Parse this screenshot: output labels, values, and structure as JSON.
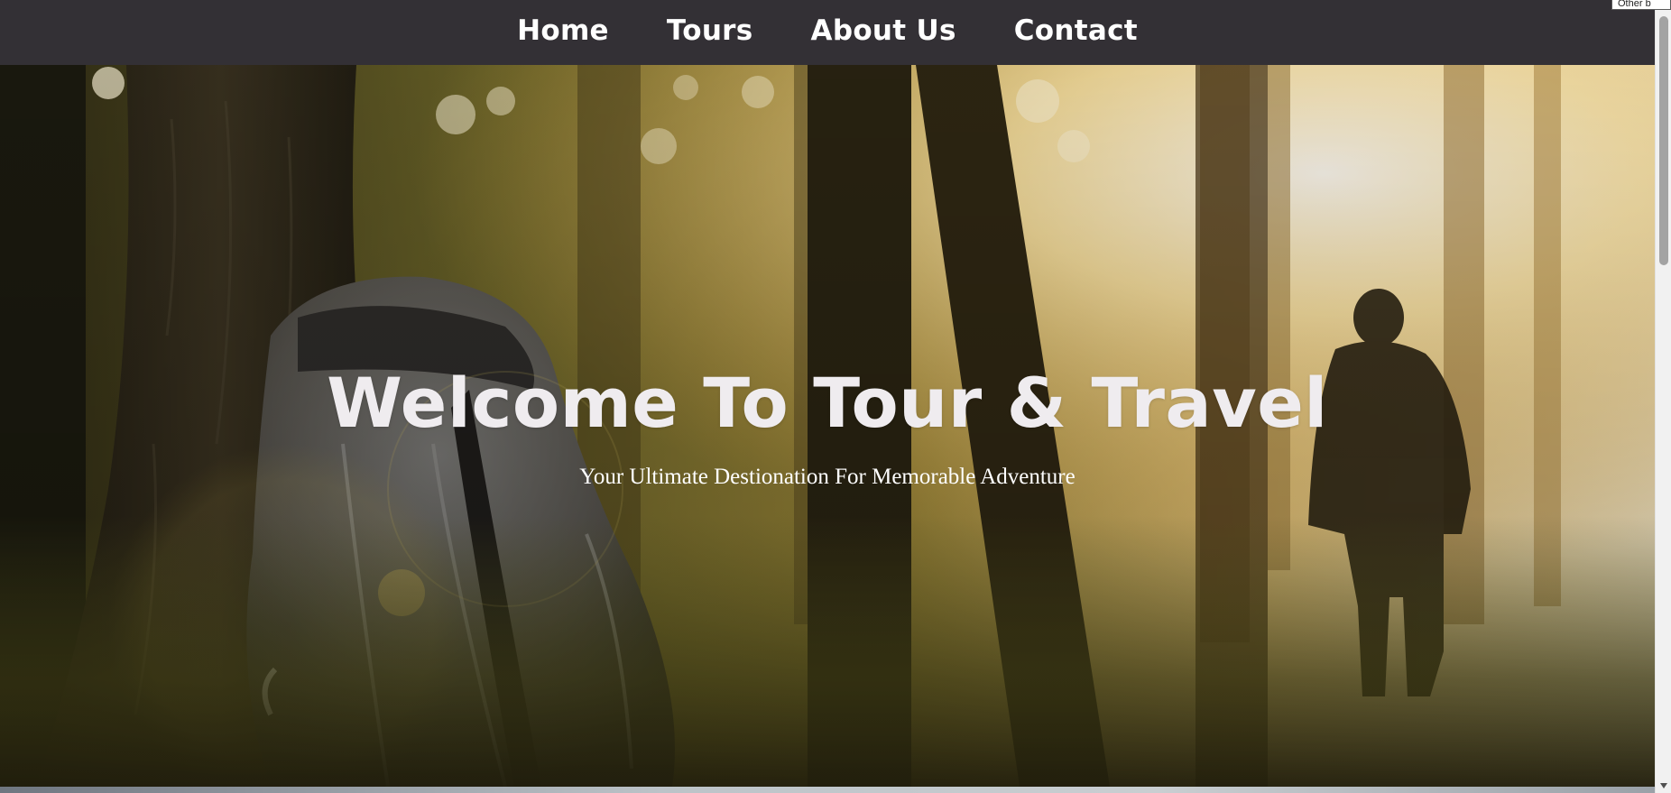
{
  "nav": {
    "items": [
      {
        "label": "Home"
      },
      {
        "label": "Tours"
      },
      {
        "label": "About Us"
      },
      {
        "label": "Contact"
      }
    ]
  },
  "hero": {
    "title": "Welcome To Tour & Travel",
    "subtitle": "Your Ultimate Destionation For Memorable Adventure"
  },
  "corner": {
    "label": "Other b"
  },
  "colors": {
    "navbar": "#333035",
    "title_text": "#efecef",
    "subtitle_text": "#ffffff",
    "scrollbar_thumb": "#a3a3a3"
  },
  "icons": {
    "scroll_up": "triangle-up-icon",
    "scroll_down": "triangle-down-icon"
  }
}
